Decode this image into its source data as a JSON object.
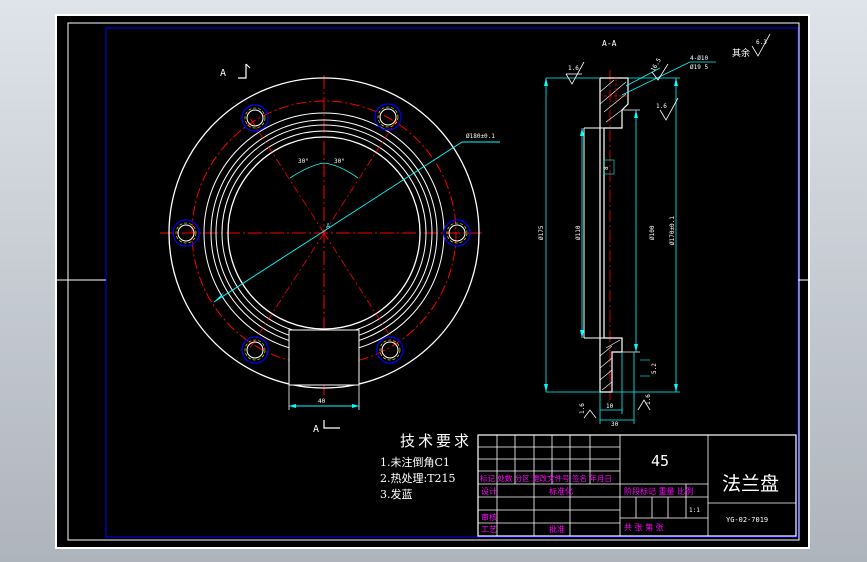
{
  "drawing": {
    "section_label": "A-A",
    "section_marker": "A",
    "center_marker": "A",
    "tech_req": {
      "title": "技术要求",
      "items": [
        "1.未注倒角C1",
        "2.热处理:T215",
        "3.发蓝"
      ]
    },
    "dims": {
      "bolt_circle": "Ø180±0.1",
      "angle_left": "30°",
      "angle_right": "30°",
      "slot_width": "40",
      "d175": "Ø175",
      "d110": "Ø110",
      "d100": "Ø100",
      "d170": "Ø170±0.1",
      "d8": "8",
      "t10": "10",
      "t30": "30",
      "hole_spec": "4-Ø10",
      "hole_spec2": "Ø19 5",
      "ra_left": "1.6",
      "ra_top": "16.5",
      "ra_mid": "1.6",
      "ra_bot_left": "1.6",
      "ra_bot_right": "1.6",
      "dim_52": "5.2",
      "rest_label": "其余",
      "rest_value": "6.3"
    },
    "title_block": {
      "material": "45",
      "part_name": "法兰盘",
      "drawing_no": "YG-02-7019",
      "scale": "1:1",
      "header_row": "标记 处数 分区 更改文件号 签名 年月日",
      "design_label": "设计",
      "std_label": "标准化",
      "stage_label": "阶段标记 重量 比例",
      "review_label": "审核",
      "process_label": "工艺",
      "approve_label": "批准",
      "sheet_label": "共 张 第 张"
    }
  },
  "colors": {
    "background": "#000000",
    "outline": "#ffffff",
    "dimension": "#00ffff",
    "centerline": "#ff0000",
    "hidden": "#ff0000",
    "annotation": "#ff00ff",
    "bolt_marker": "#0000ff",
    "hole_marker": "#ffff00"
  }
}
